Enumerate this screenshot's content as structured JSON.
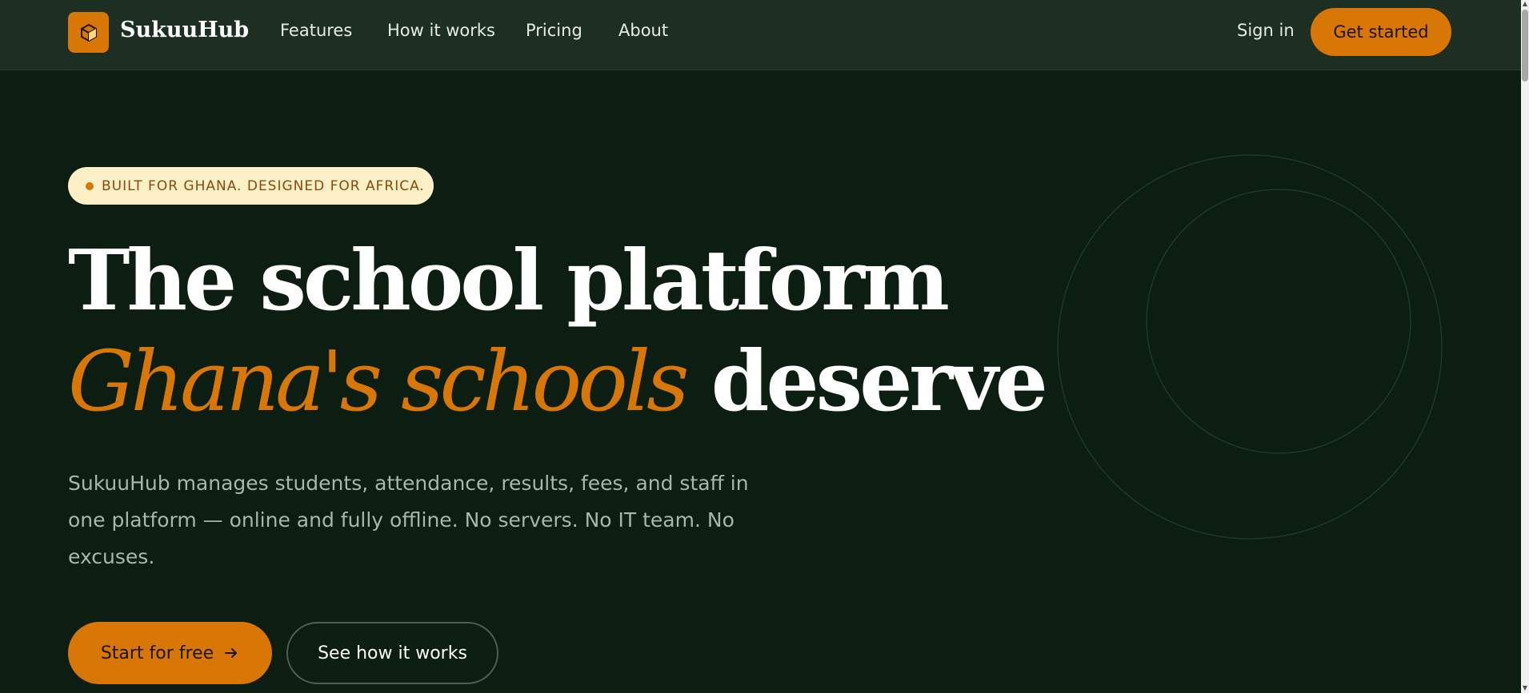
{
  "nav": {
    "brand": "SukuuHub",
    "logo_icon": "cube-icon",
    "links": [
      "Features",
      "How it works",
      "Pricing",
      "About"
    ],
    "sign_in": "Sign in",
    "cta": "Get started"
  },
  "hero": {
    "badge": "BUILT FOR GHANA. DESIGNED FOR AFRICA.",
    "headline_line1": "The school platform",
    "headline_accent": "Ghana's schools",
    "headline_end": "deserve",
    "lead": "SukuuHub manages students, attendance, results, fees, and staff in one platform — online and fully offline. No servers. No IT team. No excuses.",
    "primary_cta": "Start for free",
    "primary_cta_icon": "arrow-right-icon",
    "secondary_cta": "See how it works"
  },
  "colors": {
    "background": "#0c1d11",
    "nav_background": "#1d2f22",
    "accent": "#d97706",
    "badge_background": "#fdf0c7"
  }
}
